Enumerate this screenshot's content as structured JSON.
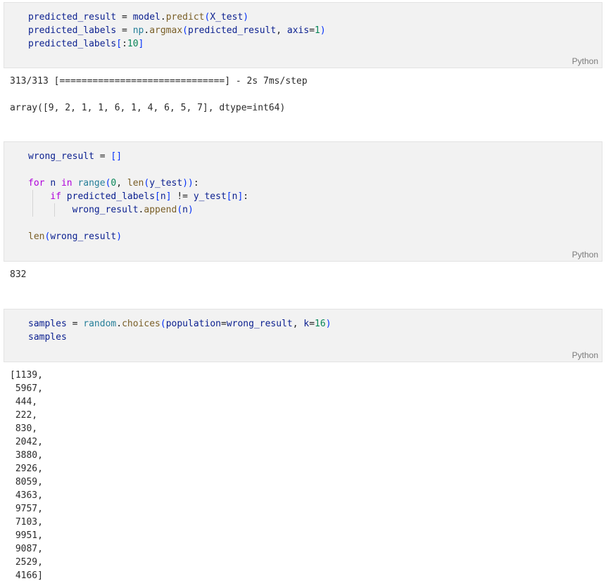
{
  "cells": [
    {
      "language": "Python",
      "lines": [
        [
          [
            "v",
            "predicted_result"
          ],
          [
            "o",
            " = "
          ],
          [
            "v",
            "model"
          ],
          [
            "o",
            "."
          ],
          [
            "f",
            "predict"
          ],
          [
            "p",
            "("
          ],
          [
            "v",
            "X_test"
          ],
          [
            "p",
            ")"
          ]
        ],
        [
          [
            "v",
            "predicted_labels"
          ],
          [
            "o",
            " = "
          ],
          [
            "m",
            "np"
          ],
          [
            "o",
            "."
          ],
          [
            "f",
            "argmax"
          ],
          [
            "p",
            "("
          ],
          [
            "v",
            "predicted_result"
          ],
          [
            "o",
            ", "
          ],
          [
            "v",
            "axis"
          ],
          [
            "o",
            "="
          ],
          [
            "n",
            "1"
          ],
          [
            "p",
            ")"
          ]
        ],
        [
          [
            "v",
            "predicted_labels"
          ],
          [
            "p",
            "["
          ],
          [
            "o",
            ":"
          ],
          [
            "n",
            "10"
          ],
          [
            "p",
            "]"
          ]
        ]
      ],
      "output": "313/313 [==============================] - 2s 7ms/step\n\narray([9, 2, 1, 1, 6, 1, 4, 6, 5, 7], dtype=int64)"
    },
    {
      "language": "Python",
      "lines": [
        [
          [
            "v",
            "wrong_result"
          ],
          [
            "o",
            " = "
          ],
          [
            "p",
            "[]"
          ]
        ],
        [],
        [
          [
            "k",
            "for"
          ],
          [
            "o",
            " "
          ],
          [
            "v",
            "n"
          ],
          [
            "o",
            " "
          ],
          [
            "k",
            "in"
          ],
          [
            "o",
            " "
          ],
          [
            "m",
            "range"
          ],
          [
            "p",
            "("
          ],
          [
            "n",
            "0"
          ],
          [
            "o",
            ", "
          ],
          [
            "f",
            "len"
          ],
          [
            "p",
            "("
          ],
          [
            "v",
            "y_test"
          ],
          [
            "p",
            "))"
          ],
          [
            "o",
            ":"
          ]
        ],
        [
          [
            "o",
            "    "
          ],
          [
            "k",
            "if"
          ],
          [
            "o",
            " "
          ],
          [
            "v",
            "predicted_labels"
          ],
          [
            "p",
            "["
          ],
          [
            "v",
            "n"
          ],
          [
            "p",
            "]"
          ],
          [
            "o",
            " != "
          ],
          [
            "v",
            "y_test"
          ],
          [
            "p",
            "["
          ],
          [
            "v",
            "n"
          ],
          [
            "p",
            "]"
          ],
          [
            "o",
            ":"
          ]
        ],
        [
          [
            "o",
            "        "
          ],
          [
            "v",
            "wrong_result"
          ],
          [
            "o",
            "."
          ],
          [
            "f",
            "append"
          ],
          [
            "p",
            "("
          ],
          [
            "v",
            "n"
          ],
          [
            "p",
            ")"
          ]
        ],
        [],
        [
          [
            "f",
            "len"
          ],
          [
            "p",
            "("
          ],
          [
            "v",
            "wrong_result"
          ],
          [
            "p",
            ")"
          ]
        ]
      ],
      "output": "832"
    },
    {
      "language": "Python",
      "lines": [
        [
          [
            "v",
            "samples"
          ],
          [
            "o",
            " = "
          ],
          [
            "m",
            "random"
          ],
          [
            "o",
            "."
          ],
          [
            "f",
            "choices"
          ],
          [
            "p",
            "("
          ],
          [
            "v",
            "population"
          ],
          [
            "o",
            "="
          ],
          [
            "v",
            "wrong_result"
          ],
          [
            "o",
            ", "
          ],
          [
            "v",
            "k"
          ],
          [
            "o",
            "="
          ],
          [
            "n",
            "16"
          ],
          [
            "p",
            ")"
          ]
        ],
        [
          [
            "v",
            "samples"
          ]
        ]
      ],
      "output": "[1139,\n 5967,\n 444,\n 222,\n 830,\n 2042,\n 3880,\n 2926,\n 8059,\n 4363,\n 9757,\n 7103,\n 9951,\n 9087,\n 2529,\n 4166]"
    }
  ],
  "colors": {
    "variable": "#0a1f8f",
    "function": "#795e26",
    "module": "#267f99",
    "keyword": "#af00db",
    "number": "#098658",
    "bracket": "#0431fa",
    "cell_background": "#f2f2f2"
  }
}
